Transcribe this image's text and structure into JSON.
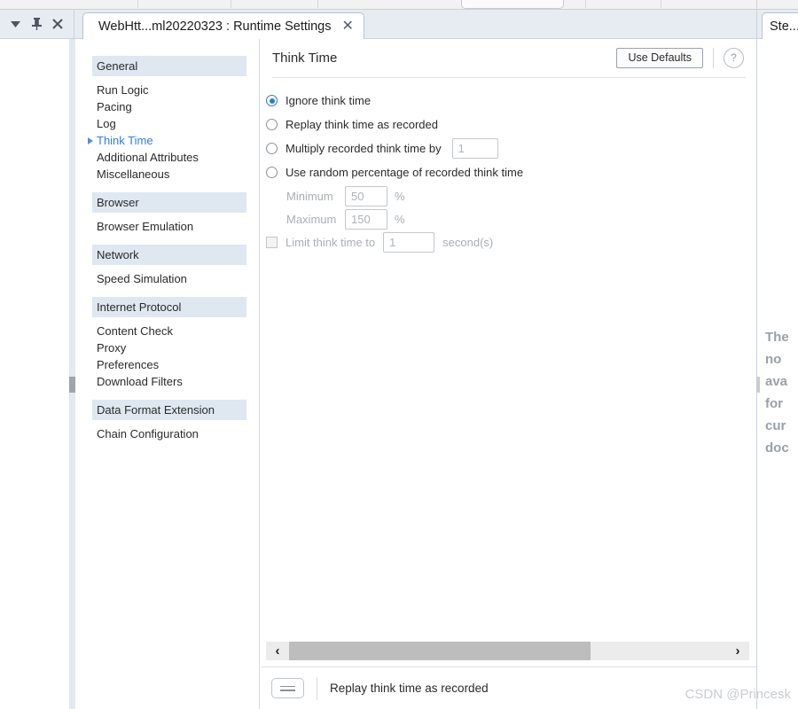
{
  "window": {
    "controls": [
      {
        "name": "dropdown",
        "glyph": "▼"
      },
      {
        "name": "pin",
        "glyph": "⚕"
      },
      {
        "name": "close",
        "glyph": "✕"
      }
    ]
  },
  "tabbar": {
    "tab_title": "WebHtt...ml20220323 : Runtime Settings",
    "close_glyph": "✕"
  },
  "sidebar": {
    "sections": [
      {
        "title": "General",
        "items": [
          {
            "label": "Run Logic",
            "active": false
          },
          {
            "label": "Pacing",
            "active": false
          },
          {
            "label": "Log",
            "active": false
          },
          {
            "label": "Think Time",
            "active": true
          },
          {
            "label": "Additional Attributes",
            "active": false
          },
          {
            "label": "Miscellaneous",
            "active": false
          }
        ]
      },
      {
        "title": "Browser",
        "items": [
          {
            "label": "Browser Emulation",
            "active": false
          }
        ]
      },
      {
        "title": "Network",
        "items": [
          {
            "label": "Speed Simulation",
            "active": false
          }
        ]
      },
      {
        "title": "Internet Protocol",
        "items": [
          {
            "label": "Content Check",
            "active": false
          },
          {
            "label": "Proxy",
            "active": false
          },
          {
            "label": "Preferences",
            "active": false
          },
          {
            "label": "Download Filters",
            "active": false
          }
        ]
      },
      {
        "title": "Data Format Extension",
        "items": [
          {
            "label": "Chain Configuration",
            "active": false
          }
        ]
      }
    ]
  },
  "content": {
    "title": "Think Time",
    "use_defaults_label": "Use Defaults",
    "help_glyph": "?",
    "options": [
      {
        "label": "Ignore think time",
        "selected": true
      },
      {
        "label": "Replay think time as recorded",
        "selected": false
      },
      {
        "label": "Multiply recorded think time by",
        "selected": false
      },
      {
        "label": "Use random percentage of recorded think time",
        "selected": false
      }
    ],
    "multiply_value": "1",
    "minimum_label": "Minimum",
    "minimum_value": "50",
    "maximum_label": "Maximum",
    "maximum_value": "150",
    "percent_symbol": "%",
    "limit_label": "Limit think time to",
    "limit_value": "1",
    "seconds_label": "second(s)"
  },
  "scrollbar": {
    "left_glyph": "‹",
    "right_glyph": "›"
  },
  "statusbar": {
    "text": "Replay think time as recorded"
  },
  "right_panel": {
    "tab_title": "Ste...",
    "message_lines": [
      "The",
      "no",
      "ava",
      "for",
      "cur",
      "doc"
    ]
  },
  "watermark": {
    "text": "CSDN @Princesk"
  },
  "colors": {
    "accent": "#2f7fe0",
    "radio_fill": "#2b7fd4",
    "section_header_bg": "#dfe7f1",
    "tabbar_bg": "#e7ecf3",
    "disabled_text": "#a9aeb5"
  }
}
